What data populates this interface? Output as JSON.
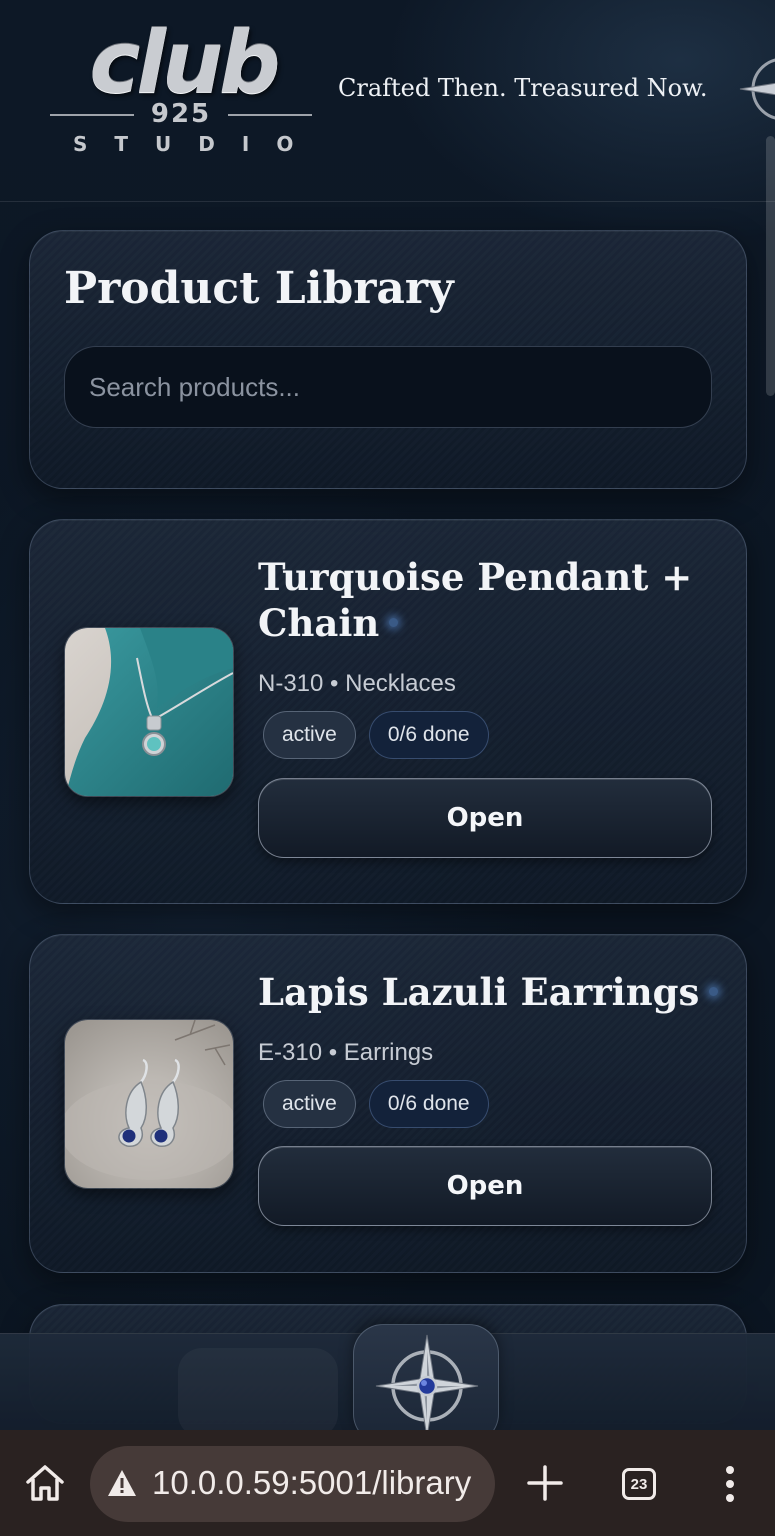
{
  "header": {
    "logo": {
      "word": "club",
      "number": "925",
      "subtitle": "STUDIO"
    },
    "tagline": "Crafted Then. Treasured Now."
  },
  "library": {
    "title": "Product Library",
    "search_placeholder": "Search products..."
  },
  "products": [
    {
      "name": "Turquoise Pendant + Chain",
      "sku": "N-310",
      "category": "Necklaces",
      "meta": "N-310 • Necklaces",
      "status": "active",
      "progress": "0/6 done",
      "action_label": "Open",
      "image_icon": "turquoise-necklace-photo"
    },
    {
      "name": "Lapis Lazuli Earrings",
      "sku": "E-310",
      "category": "Earrings",
      "meta": "E-310 • Earrings",
      "status": "active",
      "progress": "0/6 done",
      "action_label": "Open",
      "image_icon": "lapis-earrings-photo"
    }
  ],
  "bottom_nav": {
    "center_icon": "compass-star-icon"
  },
  "browser": {
    "url": "10.0.0.59:5001/library",
    "tab_count": "23",
    "security_icon": "warning-icon"
  },
  "colors": {
    "background": "#0c1622",
    "card_border": "#3b4a60",
    "accent_glow": "#5a8cd2",
    "browser_bar": "#2a2221"
  }
}
